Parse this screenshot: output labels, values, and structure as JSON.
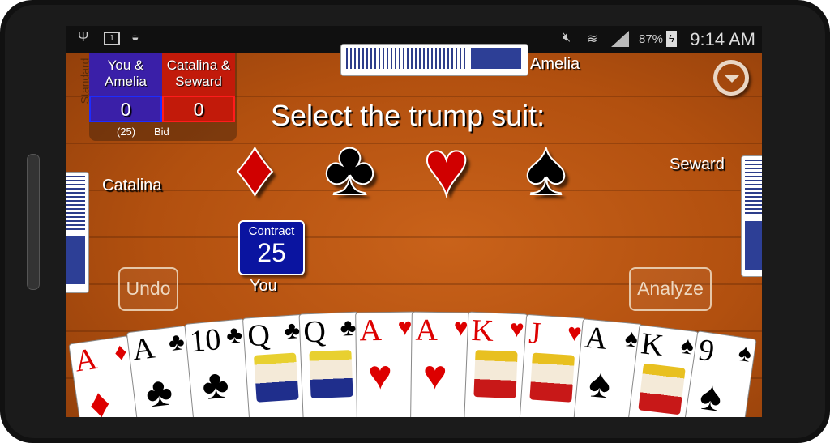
{
  "status_bar": {
    "battery": "87%",
    "time": "9:14 AM",
    "icons": [
      "usb-icon",
      "screen-1-icon",
      "wifi-shield-icon",
      "mute-icon",
      "wifi-icon",
      "signal-icon",
      "battery-charging-icon"
    ],
    "screen_number": "1"
  },
  "scoreboard": {
    "mode": "Standard",
    "team1": "You & Amelia",
    "team2": "Catalina & Seward",
    "team1_score": "0",
    "team2_score": "0",
    "bid_value": "(25)",
    "bid_label": "Bid",
    "team1_color": "#3a1fa8",
    "team2_color": "#c21a0a"
  },
  "players": {
    "north": "Amelia",
    "west": "Catalina",
    "east": "Seward",
    "south": "You"
  },
  "prompt": "Select the trump suit:",
  "suits": [
    {
      "name": "diamonds",
      "glyph": "♦",
      "color": "#d00000"
    },
    {
      "name": "clubs",
      "glyph": "♣",
      "color": "#000000"
    },
    {
      "name": "hearts",
      "glyph": "♥",
      "color": "#d00000"
    },
    {
      "name": "spades",
      "glyph": "♠",
      "color": "#000000"
    }
  ],
  "contract": {
    "label": "Contract",
    "value": "25"
  },
  "buttons": {
    "undo": "Undo",
    "analyze": "Analyze"
  },
  "hand": [
    {
      "rank": "A",
      "suit": "♦",
      "color": "red"
    },
    {
      "rank": "A",
      "suit": "♣",
      "color": "black"
    },
    {
      "rank": "10",
      "suit": "♣",
      "color": "black"
    },
    {
      "rank": "Q",
      "suit": "♣",
      "color": "black"
    },
    {
      "rank": "Q",
      "suit": "♣",
      "color": "black"
    },
    {
      "rank": "A",
      "suit": "♥",
      "color": "red"
    },
    {
      "rank": "A",
      "suit": "♥",
      "color": "red"
    },
    {
      "rank": "K",
      "suit": "♥",
      "color": "red"
    },
    {
      "rank": "J",
      "suit": "♥",
      "color": "red"
    },
    {
      "rank": "A",
      "suit": "♠",
      "color": "black"
    },
    {
      "rank": "K",
      "suit": "♠",
      "color": "black"
    },
    {
      "rank": "9",
      "suit": "♠",
      "color": "black"
    }
  ]
}
